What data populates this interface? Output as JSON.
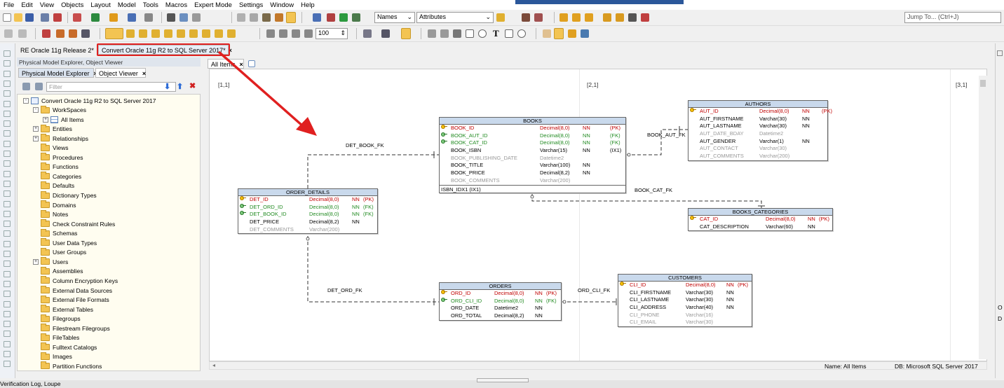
{
  "menu": [
    "File",
    "Edit",
    "View",
    "Objects",
    "Layout",
    "Model",
    "Tools",
    "Macros",
    "Expert Mode",
    "Settings",
    "Window",
    "Help"
  ],
  "toolbar": {
    "names_select": "Names",
    "attributes_select": "Attributes",
    "jump_to_placeholder": "Jump To... (Ctrl+J)",
    "zoom_value": "100"
  },
  "doc_tabs": [
    {
      "label": "RE Oracle 11g Release 2*"
    },
    {
      "label": "Convert Oracle 11g R2 to SQL Server 2017*"
    }
  ],
  "left_panel": {
    "header": "Physical Model Explorer, Object Viewer",
    "tabs": [
      {
        "label": "Physical Model Explorer"
      },
      {
        "label": "Object Viewer"
      }
    ],
    "filter_placeholder": "Filter",
    "tree": [
      {
        "label": "Convert Oracle 11g R2 to SQL Server 2017",
        "level": 0,
        "exp": "-",
        "icon": "model"
      },
      {
        "label": "WorkSpaces",
        "level": 1,
        "exp": "-",
        "icon": "folder"
      },
      {
        "label": "All Items",
        "level": 2,
        "exp": "+",
        "icon": "grid"
      },
      {
        "label": "Entities",
        "level": 1,
        "exp": "+",
        "icon": "folder"
      },
      {
        "label": "Relationships",
        "level": 1,
        "exp": "+",
        "icon": "folder"
      },
      {
        "label": "Views",
        "level": 1,
        "exp": "",
        "icon": "folder"
      },
      {
        "label": "Procedures",
        "level": 1,
        "exp": "",
        "icon": "folder"
      },
      {
        "label": "Functions",
        "level": 1,
        "exp": "",
        "icon": "folder"
      },
      {
        "label": "Categories",
        "level": 1,
        "exp": "",
        "icon": "folder"
      },
      {
        "label": "Defaults",
        "level": 1,
        "exp": "",
        "icon": "folder"
      },
      {
        "label": "Dictionary Types",
        "level": 1,
        "exp": "",
        "icon": "folder"
      },
      {
        "label": "Domains",
        "level": 1,
        "exp": "",
        "icon": "folder"
      },
      {
        "label": "Notes",
        "level": 1,
        "exp": "",
        "icon": "folder"
      },
      {
        "label": "Check Constraint Rules",
        "level": 1,
        "exp": "",
        "icon": "folder"
      },
      {
        "label": "Schemas",
        "level": 1,
        "exp": "",
        "icon": "folder"
      },
      {
        "label": "User Data Types",
        "level": 1,
        "exp": "",
        "icon": "folder"
      },
      {
        "label": "User Groups",
        "level": 1,
        "exp": "",
        "icon": "folder"
      },
      {
        "label": "Users",
        "level": 1,
        "exp": "+",
        "icon": "folder"
      },
      {
        "label": "Assemblies",
        "level": 1,
        "exp": "",
        "icon": "folder"
      },
      {
        "label": "Column Encryption Keys",
        "level": 1,
        "exp": "",
        "icon": "folder"
      },
      {
        "label": "External Data Sources",
        "level": 1,
        "exp": "",
        "icon": "folder"
      },
      {
        "label": "External File Formats",
        "level": 1,
        "exp": "",
        "icon": "folder"
      },
      {
        "label": "External Tables",
        "level": 1,
        "exp": "",
        "icon": "folder"
      },
      {
        "label": "Filegroups",
        "level": 1,
        "exp": "",
        "icon": "folder"
      },
      {
        "label": "Filestream Filegroups",
        "level": 1,
        "exp": "",
        "icon": "folder"
      },
      {
        "label": "FileTables",
        "level": 1,
        "exp": "",
        "icon": "folder"
      },
      {
        "label": "Fulltext Catalogs",
        "level": 1,
        "exp": "",
        "icon": "folder"
      },
      {
        "label": "Images",
        "level": 1,
        "exp": "",
        "icon": "folder"
      },
      {
        "label": "Partition Functions",
        "level": 1,
        "exp": "",
        "icon": "folder"
      }
    ]
  },
  "diagram": {
    "tab_label": "All Items",
    "page_labels": [
      "[1,1]",
      "[2,1]",
      "[3,1]"
    ],
    "status_name": "Name: All Items",
    "status_db": "DB: Microsoft SQL Server 2017",
    "entities": {
      "books": {
        "title": "BOOKS",
        "rows": [
          {
            "name": "BOOK_ID",
            "type": "Decimal(8,0)",
            "null": "NN",
            "key": "(PK)",
            "kind": "pk"
          },
          {
            "name": "BOOK_AUT_ID",
            "type": "Decimal(8,0)",
            "null": "NN",
            "key": "(FK)",
            "kind": "fk"
          },
          {
            "name": "BOOK_CAT_ID",
            "type": "Decimal(8,0)",
            "null": "NN",
            "key": "(FK)",
            "kind": "fk"
          },
          {
            "name": "BOOK_ISBN",
            "type": "Varchar(15)",
            "null": "NN",
            "key": "(IX1)",
            "kind": "n"
          },
          {
            "name": "BOOK_PUBLISHING_DATE",
            "type": "Datetime2",
            "null": "",
            "key": "",
            "kind": "g"
          },
          {
            "name": "BOOK_TITLE",
            "type": "Varchar(100)",
            "null": "NN",
            "key": "",
            "kind": "n"
          },
          {
            "name": "BOOK_PRICE",
            "type": "Decimal(8,2)",
            "null": "NN",
            "key": "",
            "kind": "n"
          },
          {
            "name": "BOOK_COMMENTS",
            "type": "Varchar(200)",
            "null": "",
            "key": "",
            "kind": "g"
          }
        ],
        "footer": "ISBN_IDX1 (IX1)"
      },
      "authors": {
        "title": "AUTHORS",
        "rows": [
          {
            "name": "AUT_ID",
            "type": "Decimal(8,0)",
            "null": "NN",
            "key": "(PK)",
            "kind": "pk"
          },
          {
            "name": "AUT_FIRSTNAME",
            "type": "Varchar(30)",
            "null": "NN",
            "key": "",
            "kind": "n"
          },
          {
            "name": "AUT_LASTNAME",
            "type": "Varchar(30)",
            "null": "NN",
            "key": "",
            "kind": "n"
          },
          {
            "name": "AUT_DATE_BDAY",
            "type": "Datetime2",
            "null": "",
            "key": "",
            "kind": "g"
          },
          {
            "name": "AUT_GENDER",
            "type": "Varchar(1)",
            "null": "NN",
            "key": "",
            "kind": "n"
          },
          {
            "name": "AUT_CONTACT",
            "type": "Varchar(30)",
            "null": "",
            "key": "",
            "kind": "g"
          },
          {
            "name": "AUT_COMMENTS",
            "type": "Varchar(200)",
            "null": "",
            "key": "",
            "kind": "g"
          }
        ]
      },
      "order_details": {
        "title": "ORDER_DETAILS",
        "rows": [
          {
            "name": "DET_ID",
            "type": "Decimal(8,0)",
            "null": "NN",
            "key": "(PK)",
            "kind": "pk"
          },
          {
            "name": "DET_ORD_ID",
            "type": "Decimal(8,0)",
            "null": "NN",
            "key": "(FK)",
            "kind": "fk"
          },
          {
            "name": "DET_BOOK_ID",
            "type": "Decimal(8,0)",
            "null": "NN",
            "key": "(FK)",
            "kind": "fk"
          },
          {
            "name": "DET_PRICE",
            "type": "Decimal(8,2)",
            "null": "NN",
            "key": "",
            "kind": "n"
          },
          {
            "name": "DET_COMMENTS",
            "type": "Varchar(200)",
            "null": "",
            "key": "",
            "kind": "g"
          }
        ]
      },
      "books_categories": {
        "title": "BOOKS_CATEGORIES",
        "rows": [
          {
            "name": "CAT_ID",
            "type": "Decimal(8,0)",
            "null": "NN",
            "key": "(PK)",
            "kind": "pk"
          },
          {
            "name": "CAT_DESCRIPTION",
            "type": "Varchar(60)",
            "null": "NN",
            "key": "",
            "kind": "n"
          }
        ]
      },
      "orders": {
        "title": "ORDERS",
        "rows": [
          {
            "name": "ORD_ID",
            "type": "Decimal(8,0)",
            "null": "NN",
            "key": "(PK)",
            "kind": "pk"
          },
          {
            "name": "ORD_CLI_ID",
            "type": "Decimal(8,0)",
            "null": "NN",
            "key": "(FK)",
            "kind": "fk"
          },
          {
            "name": "ORD_DATE",
            "type": "Datetime2",
            "null": "NN",
            "key": "",
            "kind": "n"
          },
          {
            "name": "ORD_TOTAL",
            "type": "Decimal(8,2)",
            "null": "NN",
            "key": "",
            "kind": "n"
          }
        ]
      },
      "customers": {
        "title": "CUSTOMERS",
        "rows": [
          {
            "name": "CLI_ID",
            "type": "Decimal(8,0)",
            "null": "NN",
            "key": "(PK)",
            "kind": "pk"
          },
          {
            "name": "CLI_FIRSTNAME",
            "type": "Varchar(30)",
            "null": "NN",
            "key": "",
            "kind": "n"
          },
          {
            "name": "CLI_LASTNAME",
            "type": "Varchar(30)",
            "null": "NN",
            "key": "",
            "kind": "n"
          },
          {
            "name": "CLI_ADDRESS",
            "type": "Varchar(40)",
            "null": "NN",
            "key": "",
            "kind": "n"
          },
          {
            "name": "CLI_PHONE",
            "type": "Varchar(16)",
            "null": "",
            "key": "",
            "kind": "g"
          },
          {
            "name": "CLI_EMAIL",
            "type": "Varchar(30)",
            "null": "",
            "key": "",
            "kind": "g"
          }
        ]
      }
    },
    "relationships": [
      "DET_BOOK_FK",
      "BOOK_AUT_FK",
      "BOOK_CAT_FK",
      "DET_ORD_FK",
      "ORD_CLI_FK"
    ]
  },
  "statusbar": {
    "text": "Verification Log, Loupe"
  },
  "colors": {
    "pk": "#c00000",
    "fk": "#228b22",
    "highlight": "#e02020",
    "entity_header": "#c9d9ec"
  }
}
